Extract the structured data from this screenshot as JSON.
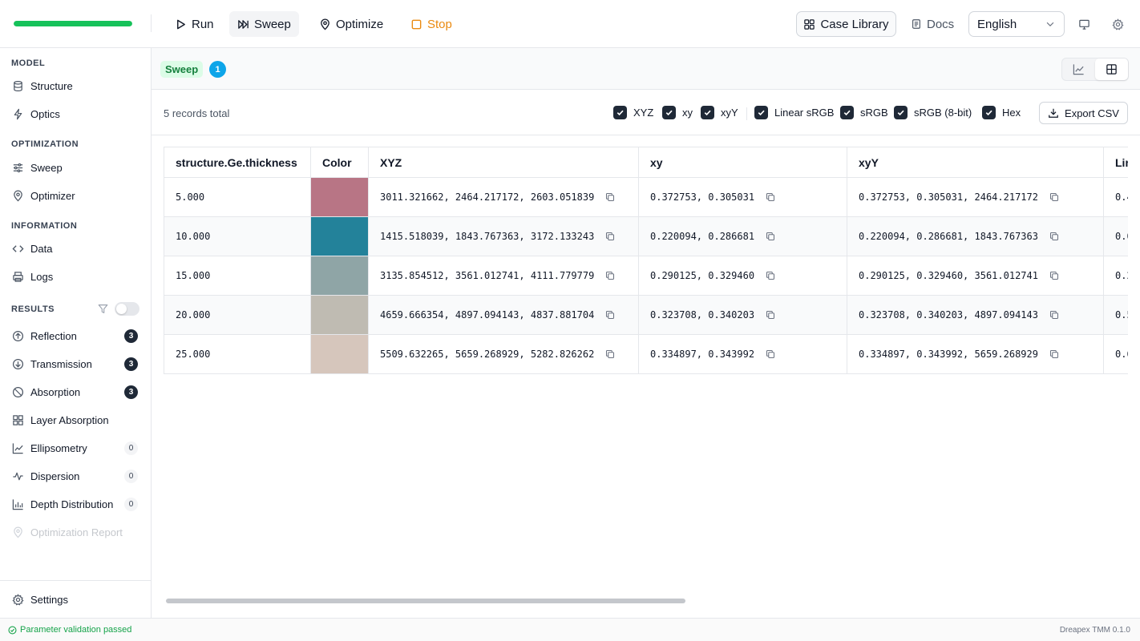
{
  "progress": {
    "fraction": 1.0,
    "color": "#16c25a"
  },
  "toolbar": {
    "run": "Run",
    "sweep": "Sweep",
    "optimize": "Optimize",
    "stop": "Stop",
    "case_library": "Case Library",
    "docs": "Docs",
    "language": "English"
  },
  "sidebar": {
    "model_title": "MODEL",
    "structure": "Structure",
    "optics": "Optics",
    "optimization_title": "OPTIMIZATION",
    "sweep": "Sweep",
    "optimizer": "Optimizer",
    "information_title": "INFORMATION",
    "data": "Data",
    "logs": "Logs",
    "results_title": "RESULTS",
    "results": [
      {
        "label": "Reflection",
        "count": "3",
        "style": "dark"
      },
      {
        "label": "Transmission",
        "count": "3",
        "style": "dark"
      },
      {
        "label": "Absorption",
        "count": "3",
        "style": "dark"
      },
      {
        "label": "Layer Absorption",
        "count": "",
        "style": "none"
      },
      {
        "label": "Ellipsometry",
        "count": "0",
        "style": "light"
      },
      {
        "label": "Dispersion",
        "count": "0",
        "style": "light"
      },
      {
        "label": "Depth Distribution",
        "count": "0",
        "style": "light"
      },
      {
        "label": "Optimization Report",
        "count": "",
        "style": "disabled"
      }
    ],
    "settings": "Settings"
  },
  "tabbar": {
    "tag": "Sweep",
    "count": "1"
  },
  "records_total": "5 records total",
  "columns_toggles": [
    {
      "label": "XYZ",
      "checked": true
    },
    {
      "label": "xy",
      "checked": true
    },
    {
      "label": "xyY",
      "checked": true
    },
    {
      "label": "Linear sRGB",
      "checked": true
    },
    {
      "label": "sRGB",
      "checked": true
    },
    {
      "label": "sRGB (8-bit)",
      "checked": true
    },
    {
      "label": "Hex",
      "checked": true
    }
  ],
  "export_label": "Export CSV",
  "table": {
    "headers": [
      "structure.Ge.thickness",
      "Color",
      "XYZ",
      "xy",
      "xyY",
      "Lir"
    ],
    "rows": [
      {
        "thickness": "5.000",
        "color": "#b87585",
        "xyz": "3011.321662, 2464.217172, 2603.051839",
        "xy": "0.372753, 0.305031",
        "xyY": "0.372753, 0.305031, 2464.217172",
        "lin": "0.4"
      },
      {
        "thickness": "10.000",
        "color": "#23829a",
        "xyz": "1415.518039, 1843.767363, 3172.133243",
        "xy": "0.220094, 0.286681",
        "xyY": "0.220094, 0.286681, 1843.767363",
        "lin": "0.0"
      },
      {
        "thickness": "15.000",
        "color": "#8fa5a6",
        "xyz": "3135.854512, 3561.012741, 4111.779779",
        "xy": "0.290125, 0.329460",
        "xyY": "0.290125, 0.329460, 3561.012741",
        "lin": "0.2"
      },
      {
        "thickness": "20.000",
        "color": "#bfbbb2",
        "xyz": "4659.666354, 4897.094143, 4837.881704",
        "xy": "0.323708, 0.340203",
        "xyY": "0.323708, 0.340203, 4897.094143",
        "lin": "0.5"
      },
      {
        "thickness": "25.000",
        "color": "#d6c6bc",
        "xyz": "5509.632265, 5659.268929, 5282.826262",
        "xy": "0.334897, 0.343992",
        "xyY": "0.334897, 0.343992, 5659.268929",
        "lin": "0.6"
      }
    ]
  },
  "status": {
    "message": "Parameter validation passed",
    "version": "Dreapex TMM 0.1.0"
  }
}
